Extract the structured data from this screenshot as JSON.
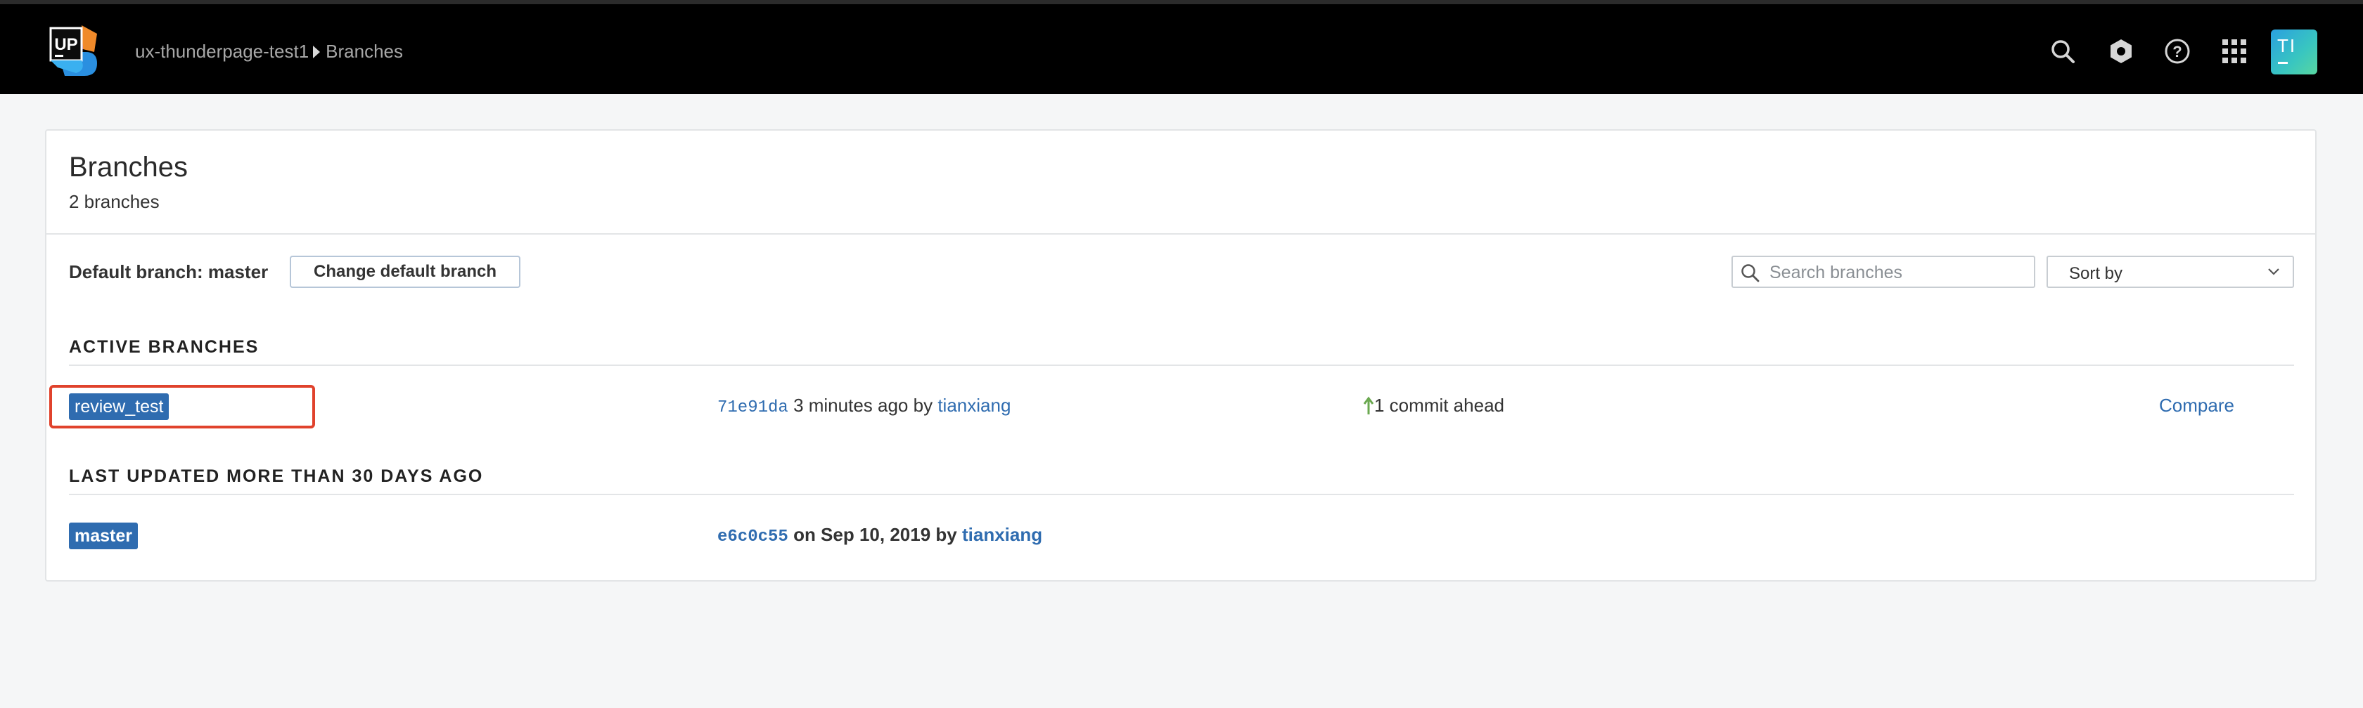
{
  "header": {
    "logo_text": "UP",
    "breadcrumb": [
      "ux-thunderpage-test1",
      "Branches"
    ],
    "icons": [
      "search-icon",
      "gear-icon",
      "help-icon",
      "apps-grid-icon"
    ],
    "avatar_initials": "TI"
  },
  "page": {
    "title": "Branches",
    "subtitle": "2 branches"
  },
  "toolbar": {
    "default_branch_label": "Default branch: master",
    "change_default_button": "Change default branch",
    "search_placeholder": "Search branches",
    "sort_label": "Sort by"
  },
  "sections": [
    {
      "heading": "ACTIVE BRANCHES",
      "branches": [
        {
          "name": "review_test",
          "sha": "71e91da",
          "when": "3 minutes ago",
          "by": "by",
          "author": "tianxiang",
          "ahead": "1 commit ahead",
          "compare": "Compare"
        }
      ]
    },
    {
      "heading": "LAST UPDATED MORE THAN 30 DAYS AGO",
      "branches": [
        {
          "name": "master",
          "sha": "e6c0c55",
          "when": "on Sep 10, 2019",
          "by": "by",
          "author": "tianxiang"
        }
      ]
    }
  ],
  "colors": {
    "topbar": "#000000",
    "accent": "#2f6cb0",
    "highlight": "#e0422c",
    "ahead_arrow": "#6aa84f"
  }
}
